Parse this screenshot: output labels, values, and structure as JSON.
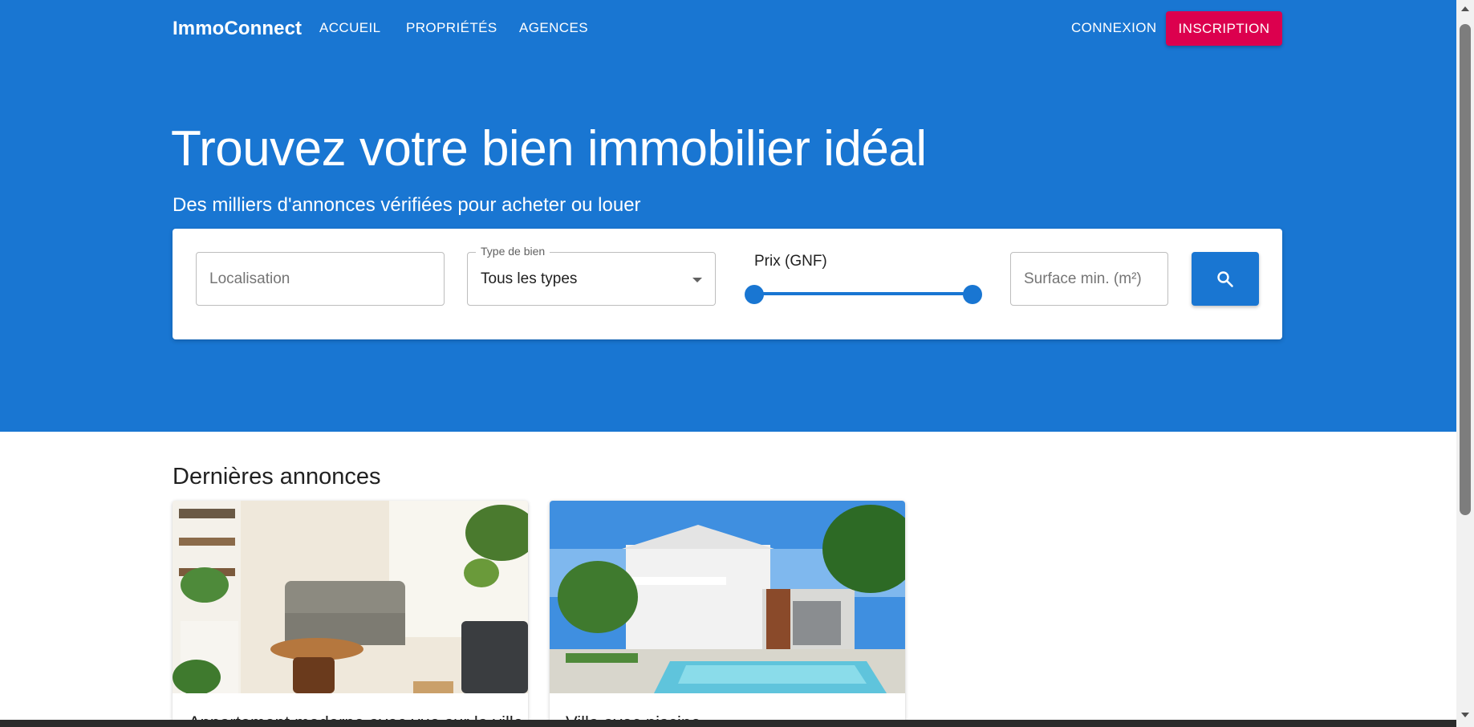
{
  "nav": {
    "brand": "ImmoConnect",
    "links": [
      "ACCUEIL",
      "PROPRIÉTÉS",
      "AGENCES"
    ],
    "login": "CONNEXION",
    "signup": "INSCRIPTION"
  },
  "hero": {
    "title": "Trouvez votre bien immobilier idéal",
    "subtitle": "Des milliers d'annonces vérifiées pour acheter ou louer"
  },
  "search": {
    "location_placeholder": "Localisation",
    "type_label": "Type de bien",
    "type_value": "Tous les types",
    "price_label": "Prix (GNF)",
    "price_range_fraction": [
      0,
      1
    ],
    "surface_placeholder": "Surface min. (m²)",
    "search_icon": "search-icon"
  },
  "listings": {
    "section_title": "Dernières annonces",
    "cards": [
      {
        "title": "Appartement moderne avec vue sur la ville",
        "image": "living-room-photo"
      },
      {
        "title": "Villa avec piscine",
        "image": "villa-pool-photo"
      }
    ]
  },
  "colors": {
    "primary": "#1976d2",
    "secondary": "#dc004e",
    "text": "#212121"
  }
}
